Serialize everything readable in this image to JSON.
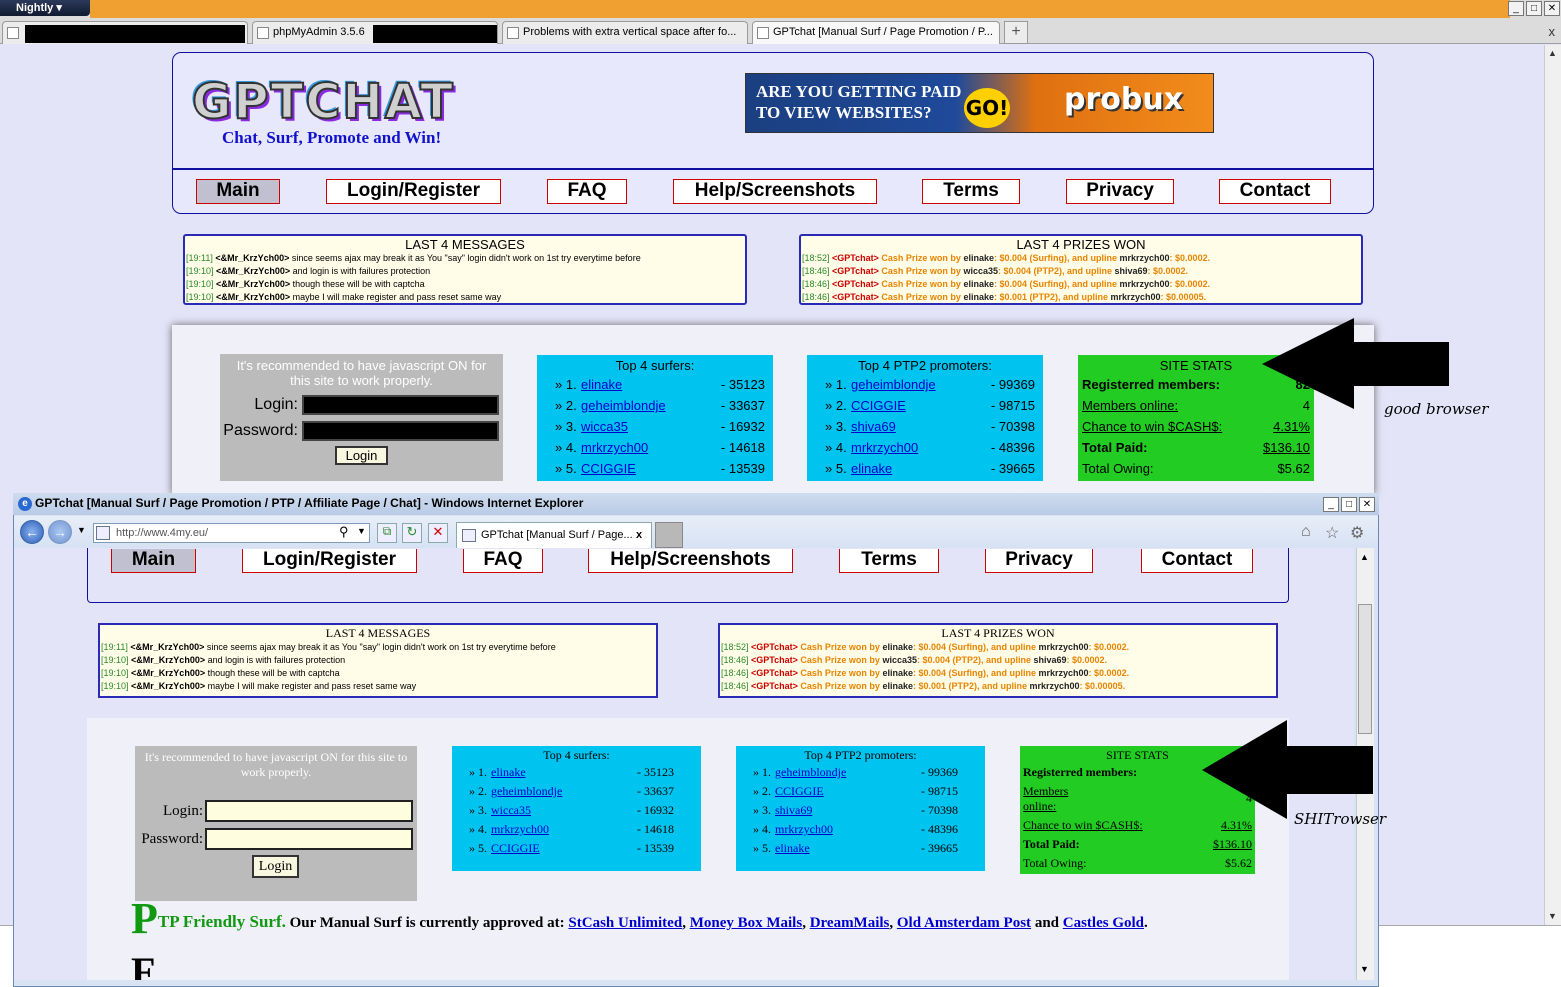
{
  "firefox": {
    "menu_label": "Nightly",
    "tabs": [
      "phpMyAdmin 3.5.6",
      "Problems with extra vertical space after fo...",
      "GPTchat [Manual Surf / Page Promotion / P..."
    ],
    "new_tab": "+",
    "close_tab": "x"
  },
  "site": {
    "logo_text": "GPTCHAT",
    "tagline": "Chat, Surf, Promote and Win!",
    "banner_line1": "ARE YOU GETTING PAID",
    "banner_line2": "TO VIEW WEBSITES?",
    "banner_go": "GO!",
    "banner_brand": "probux",
    "nav": [
      "Main",
      "Login/Register",
      "FAQ",
      "Help/Screenshots",
      "Terms",
      "Privacy",
      "Contact"
    ],
    "messages_title": "LAST 4 MESSAGES",
    "messages": [
      {
        "time": "[19:11]",
        "user": "<&Mr_KrzYch00>",
        "text": " since seems ajax may break it as You \"say\" login didn't work on 1st try everytime before"
      },
      {
        "time": "[19:10]",
        "user": "<&Mr_KrzYch00>",
        "text": " and login is with failures protection"
      },
      {
        "time": "[19:10]",
        "user": "<&Mr_KrzYch00>",
        "text": " though these will be with captcha"
      },
      {
        "time": "[19:10]",
        "user": "<&Mr_KrzYch00>",
        "text": " maybe I will make register and pass reset same way"
      }
    ],
    "prizes_title": "LAST 4 PRIZES WON",
    "prizes": [
      {
        "time": "[18:52]",
        "bot": "<GPTchat>",
        "p1": " Cash Prize won by ",
        "winner": "elinake",
        "p2": ": $0.004 (Surfing), and upline ",
        "upline": "mrkrzych00",
        "p3": ": $0.0002."
      },
      {
        "time": "[18:46]",
        "bot": "<GPTchat>",
        "p1": " Cash Prize won by ",
        "winner": "wicca35",
        "p2": ": $0.004 (PTP2), and upline ",
        "upline": "shiva69",
        "p3": ": $0.0002."
      },
      {
        "time": "[18:46]",
        "bot": "<GPTchat>",
        "p1": " Cash Prize won by ",
        "winner": "elinake",
        "p2": ": $0.004 (Surfing), and upline ",
        "upline": "mrkrzych00",
        "p3": ": $0.0002."
      },
      {
        "time": "[18:46]",
        "bot": "<GPTchat>",
        "p1": " Cash Prize won by ",
        "winner": "elinake",
        "p2": ": $0.001 (PTP2), and upline ",
        "upline": "mrkrzych00",
        "p3": ": $0.00005."
      }
    ],
    "js_note": "It's recommended to have javascript ON for this site to work properly.",
    "login_label": "Login:",
    "password_label": "Password:",
    "login_button": "Login",
    "surfers_title": "Top 4 surfers:",
    "surfers": [
      {
        "rank": "» 1.",
        "name": "elinake",
        "score": "- 35123"
      },
      {
        "rank": "» 2.",
        "name": "geheimblondje",
        "score": "- 33637"
      },
      {
        "rank": "» 3.",
        "name": "wicca35",
        "score": "- 16932"
      },
      {
        "rank": "» 4.",
        "name": "mrkrzych00",
        "score": "- 14618"
      },
      {
        "rank": "» 5.",
        "name": "CCIGGIE",
        "score": "- 13539"
      }
    ],
    "ptp_title": "Top 4 PTP2 promoters:",
    "ptp": [
      {
        "rank": "» 1.",
        "name": "geheimblondje",
        "score": "- 99369"
      },
      {
        "rank": "» 2.",
        "name": "CCIGGIE",
        "score": "- 98715"
      },
      {
        "rank": "» 3.",
        "name": "shiva69",
        "score": "- 70398"
      },
      {
        "rank": "» 4.",
        "name": "mrkrzych00",
        "score": "- 48396"
      },
      {
        "rank": "» 5.",
        "name": "elinake",
        "score": "- 39665"
      }
    ],
    "stats_title": "SITE STATS",
    "stats": {
      "registered_label": "Registerred members:",
      "registered_value": "82",
      "registered_value_ie": "",
      "online_label": "Members online:",
      "online_value": "4",
      "chance_label": "Chance to win $CASH$:",
      "chance_value": "4.31%",
      "paid_label": "Total Paid:",
      "paid_value": "$136.10",
      "owing_label": "Total Owing:",
      "owing_value": "$5.62"
    },
    "ptp_line_big": "P",
    "ptp_line_green": "TP Friendly Surf.",
    "ptp_line_text": " Our Manual Surf is currently approved at: ",
    "approved_sites": [
      "StCash Unlimited",
      "Money Box Mails",
      "DreamMails",
      "Old Amsterdam Post",
      "Castles Gold"
    ],
    "ptp_line_and": " and ",
    "ptp_line_end": ".",
    "next_big": "F"
  },
  "annotations": {
    "good": "good browser",
    "bad": "SHITrowser"
  },
  "ie": {
    "title": "GPTchat [Manual Surf / Page Promotion / PTP / Affiliate Page / Chat] - Windows Internet Explorer",
    "address": "http://www.4my.eu/",
    "tab": "GPTchat [Manual Surf / Page...",
    "tab_close": "x"
  },
  "colors": {
    "accent_blue": "#2a2ab8",
    "surfers_bg": "#00c4f0",
    "stats_bg": "#22cc22",
    "prize_orange": "#e88400",
    "gpt_red": "#cc0000"
  }
}
